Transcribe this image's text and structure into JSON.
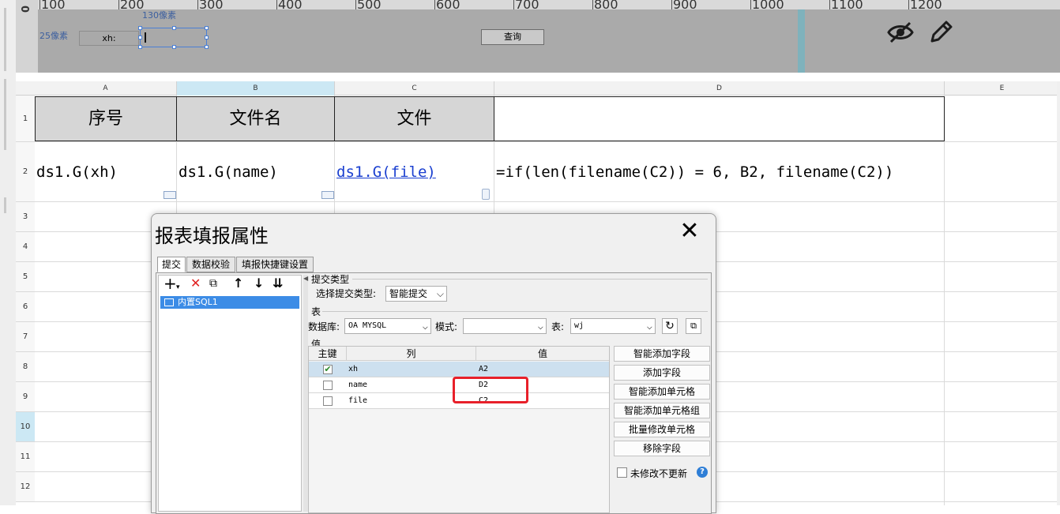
{
  "param_pane": {
    "ruler_origin": "0",
    "ruler_marks": [
      "100",
      "200",
      "300",
      "400",
      "500",
      "600",
      "700",
      "800",
      "900",
      "1000",
      "1100",
      "1200"
    ],
    "width_label": "130像素",
    "height_label": "25像素",
    "field_label": "xh:",
    "query_button": "查询",
    "icons": [
      "eye-off-icon",
      "pencil-icon"
    ]
  },
  "sheet": {
    "select_all": ":::",
    "columns": [
      "A",
      "B",
      "C",
      "D",
      "E"
    ],
    "rows": [
      "1",
      "2",
      "3",
      "4",
      "5",
      "6",
      "7",
      "8",
      "9",
      "10",
      "11",
      "12"
    ],
    "headers": {
      "a1": "序号",
      "b1": "文件名",
      "c1": "文件"
    },
    "cells": {
      "a2": "ds1.G(xh)",
      "b2": "ds1.G(name)",
      "c2": "ds1.G(file)",
      "d2": "=if(len(filename(C2)) = 6, B2, filename(C2))"
    },
    "link_color": "#1a3fd0",
    "active_row": "10",
    "active_col": "B"
  },
  "dialog": {
    "title": "报表填报属性",
    "close": "✕",
    "tabs": [
      "提交",
      "数据校验",
      "填报快捷键设置"
    ],
    "toolbar": {
      "add": "+",
      "add_arrow": "▾",
      "delete": "✕",
      "copy": "⧉",
      "up": "↑",
      "down": "↓",
      "move_bottom": "⇊"
    },
    "submit_items": [
      "内置SQL1"
    ],
    "submit_type_section": "提交类型",
    "submit_type_label": "选择提交类型:",
    "submit_type_value": "智能提交",
    "table_section": "表",
    "database_label": "数据库:",
    "database_value": "OA MYSQL",
    "schema_label": "模式:",
    "schema_value": "",
    "table_label": "表:",
    "table_value": "wj",
    "value_section": "值",
    "grid_headers": [
      "主键",
      "列",
      "值"
    ],
    "grid_rows": [
      {
        "key": true,
        "column": "xh",
        "value": "A2"
      },
      {
        "key": false,
        "column": "name",
        "value": "D2"
      },
      {
        "key": false,
        "column": "file",
        "value": "C2"
      }
    ],
    "side_buttons": [
      "智能添加字段",
      "添加字段",
      "智能添加单元格",
      "智能添加单元格组",
      "批量修改单元格",
      "移除字段"
    ],
    "no_update_label": "未修改不更新",
    "help": "?",
    "highlight_color": "#e8202a"
  }
}
